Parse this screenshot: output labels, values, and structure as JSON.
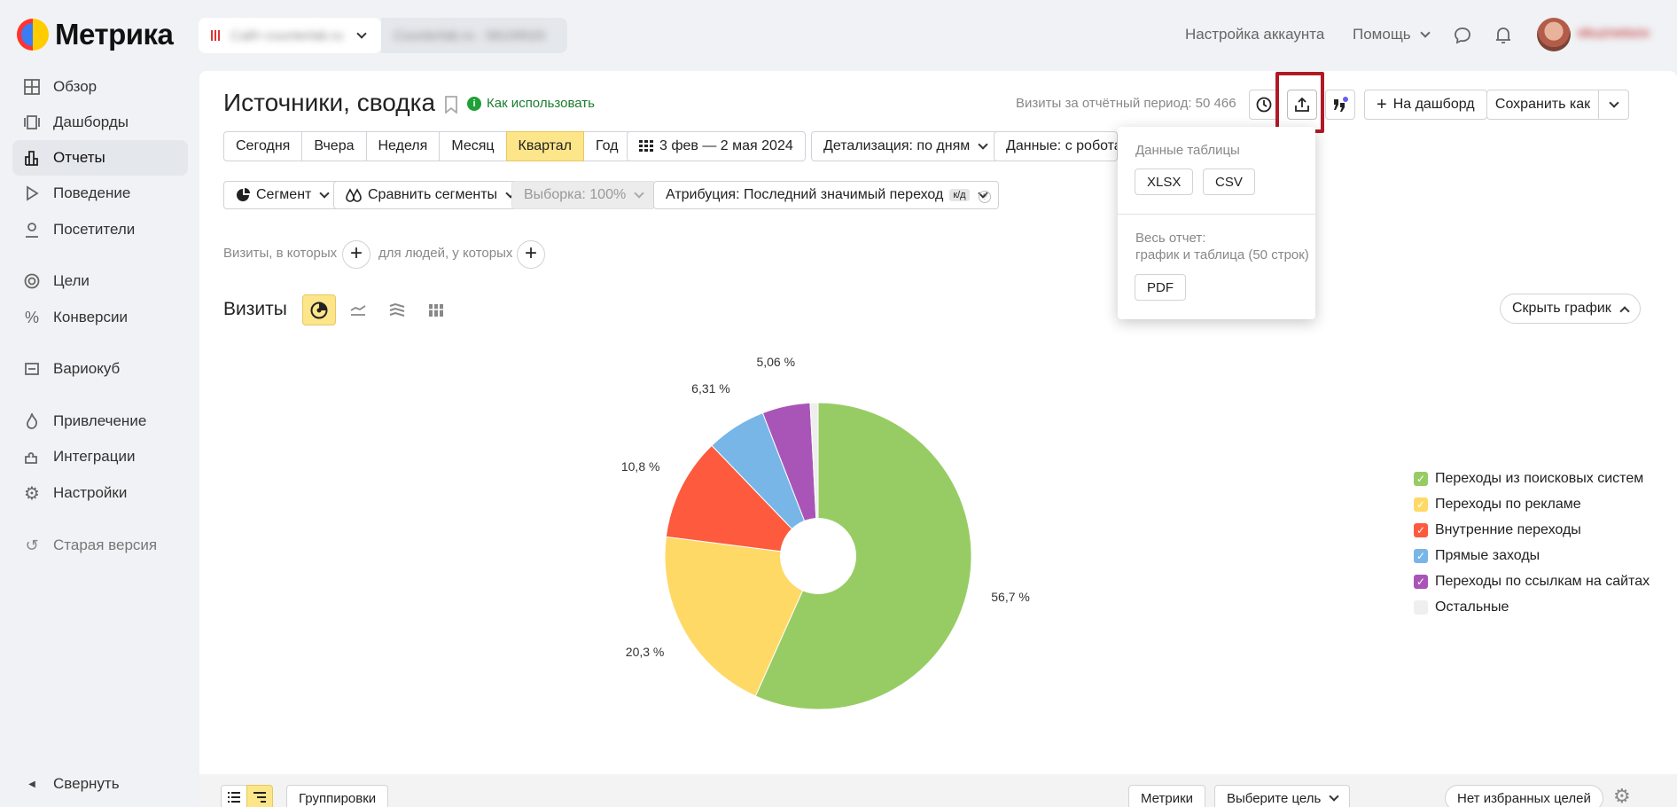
{
  "brand": {
    "name": "Метрика"
  },
  "counter": {
    "name": "Сайт-counterlab.ru",
    "id": "Counterlab.ru · 58109520"
  },
  "topbar": {
    "account_settings": "Настройка аккаунта",
    "help": "Помощь",
    "user_name": "ekuznetsov"
  },
  "sidebar": {
    "items": [
      {
        "label": "Обзор",
        "icon": "grid-icon"
      },
      {
        "label": "Дашборды",
        "icon": "dashboard-icon"
      },
      {
        "label": "Отчеты",
        "icon": "bar-chart-icon"
      },
      {
        "label": "Поведение",
        "icon": "play-icon"
      },
      {
        "label": "Посетители",
        "icon": "user-icon"
      },
      {
        "label": "Цели",
        "icon": "target-icon"
      },
      {
        "label": "Конверсии",
        "icon": "percent-icon"
      },
      {
        "label": "Вариокуб",
        "icon": "cube-icon"
      },
      {
        "label": "Привлечение",
        "icon": "flame-icon"
      },
      {
        "label": "Интеграции",
        "icon": "puzzle-icon"
      },
      {
        "label": "Настройки",
        "icon": "gear-icon"
      },
      {
        "label": "Старая версия",
        "icon": "history-icon"
      }
    ],
    "collapse": "Свернуть"
  },
  "report": {
    "title": "Источники, сводка",
    "how_to": "Как использовать",
    "visits_label": "Визиты за отчётный период: 50 466"
  },
  "actions": {
    "to_dashboard": "На дашборд",
    "save_as": "Сохранить как"
  },
  "periods": [
    "Сегодня",
    "Вчера",
    "Неделя",
    "Месяц",
    "Квартал",
    "Год"
  ],
  "period_active": "Квартал",
  "date_range": "3 фев — 2 мая 2024",
  "detail": "Детализация: по дням",
  "data_filter": "Данные: с роботам",
  "segment": "Сегмент",
  "compare": "Сравнить сегменты",
  "sample": "Выборка: 100%",
  "attribution": "Атрибуция: Последний значимый переход",
  "attribution_badge": "к/д",
  "filters": {
    "visits_where": "Визиты, в которых",
    "people_where": "для людей, у которых"
  },
  "export_menu": {
    "table_data": "Данные таблицы",
    "xlsx": "XLSX",
    "csv": "CSV",
    "whole_report": "Весь отчет:",
    "whole_report_sub": "график и таблица (50 строк)",
    "pdf": "PDF"
  },
  "chart_section": {
    "title": "Визиты",
    "hide_chart": "Скрыть график"
  },
  "bottom": {
    "groupings": "Группировки",
    "metrics": "Метрики",
    "choose_goal": "Выберите цель",
    "no_fav_goals": "Нет избранных целей"
  },
  "chart_data": {
    "type": "pie",
    "title": "Визиты",
    "slices": [
      {
        "name": "Переходы из поисковых систем",
        "value": 56.7,
        "label": "56,7 %",
        "color": "#97cc64"
      },
      {
        "name": "Переходы по рекламе",
        "value": 20.3,
        "label": "20,3 %",
        "color": "#ffd966"
      },
      {
        "name": "Внутренние переходы",
        "value": 10.8,
        "label": "10,8 %",
        "color": "#fd5a3e"
      },
      {
        "name": "Прямые заходы",
        "value": 6.31,
        "label": "6,31 %",
        "color": "#77b6e7"
      },
      {
        "name": "Переходы по ссылкам на сайтах",
        "value": 5.06,
        "label": "5,06 %",
        "color": "#a955b8"
      },
      {
        "name": "Остальные",
        "value": 0.83,
        "label": "",
        "color": "#eeeeee"
      }
    ],
    "legend_position": "right"
  }
}
